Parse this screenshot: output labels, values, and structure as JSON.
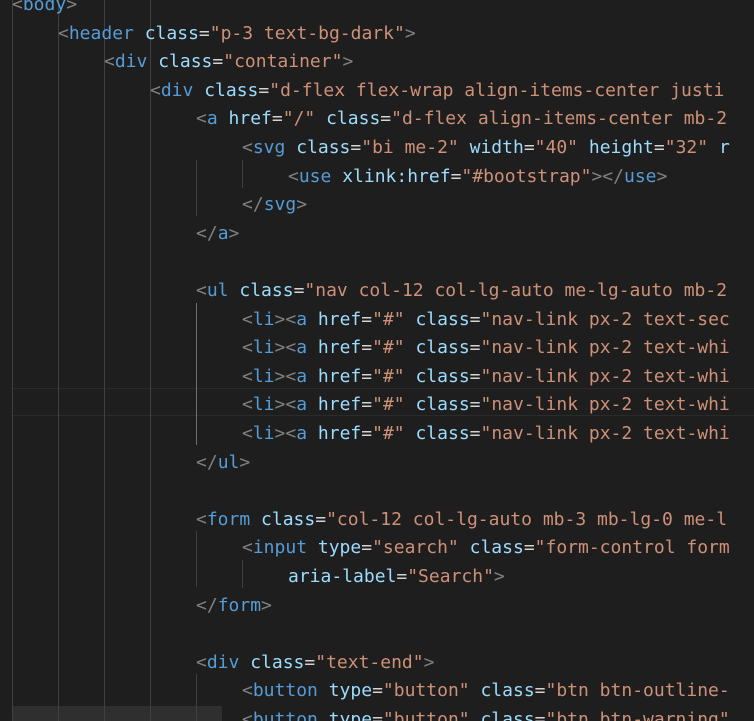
{
  "editor": {
    "lines": [
      [
        {
          "c": "b",
          "v": "<"
        },
        {
          "c": "t",
          "v": "body"
        },
        {
          "c": "b",
          "v": ">"
        }
      ],
      [
        {
          "c": "b",
          "v": "<"
        },
        {
          "c": "t",
          "v": "header"
        },
        {
          "c": "e",
          "v": " "
        },
        {
          "c": "a",
          "v": "class"
        },
        {
          "c": "e",
          "v": "="
        },
        {
          "c": "s",
          "v": "\"p-3 text-bg-dark\""
        },
        {
          "c": "b",
          "v": ">"
        }
      ],
      [
        {
          "c": "b",
          "v": "<"
        },
        {
          "c": "t",
          "v": "div"
        },
        {
          "c": "e",
          "v": " "
        },
        {
          "c": "a",
          "v": "class"
        },
        {
          "c": "e",
          "v": "="
        },
        {
          "c": "s",
          "v": "\"container\""
        },
        {
          "c": "b",
          "v": ">"
        }
      ],
      [
        {
          "c": "b",
          "v": "<"
        },
        {
          "c": "t",
          "v": "div"
        },
        {
          "c": "e",
          "v": " "
        },
        {
          "c": "a",
          "v": "class"
        },
        {
          "c": "e",
          "v": "="
        },
        {
          "c": "s",
          "v": "\"d-flex flex-wrap align-items-center justi"
        }
      ],
      [
        {
          "c": "b",
          "v": "<"
        },
        {
          "c": "t",
          "v": "a"
        },
        {
          "c": "e",
          "v": " "
        },
        {
          "c": "a",
          "v": "href"
        },
        {
          "c": "e",
          "v": "="
        },
        {
          "c": "s",
          "v": "\"/\""
        },
        {
          "c": "e",
          "v": " "
        },
        {
          "c": "a",
          "v": "class"
        },
        {
          "c": "e",
          "v": "="
        },
        {
          "c": "s",
          "v": "\"d-flex align-items-center mb-2"
        }
      ],
      [
        {
          "c": "b",
          "v": "<"
        },
        {
          "c": "t",
          "v": "svg"
        },
        {
          "c": "e",
          "v": " "
        },
        {
          "c": "a",
          "v": "class"
        },
        {
          "c": "e",
          "v": "="
        },
        {
          "c": "s",
          "v": "\"bi me-2\""
        },
        {
          "c": "e",
          "v": " "
        },
        {
          "c": "a",
          "v": "width"
        },
        {
          "c": "e",
          "v": "="
        },
        {
          "c": "s",
          "v": "\"40\""
        },
        {
          "c": "e",
          "v": " "
        },
        {
          "c": "a",
          "v": "height"
        },
        {
          "c": "e",
          "v": "="
        },
        {
          "c": "s",
          "v": "\"32\""
        },
        {
          "c": "e",
          "v": " "
        },
        {
          "c": "a",
          "v": "r"
        }
      ],
      [
        {
          "c": "b",
          "v": "<"
        },
        {
          "c": "t",
          "v": "use"
        },
        {
          "c": "e",
          "v": " "
        },
        {
          "c": "a",
          "v": "xlink:href"
        },
        {
          "c": "e",
          "v": "="
        },
        {
          "c": "s",
          "v": "\"#bootstrap\""
        },
        {
          "c": "b",
          "v": "></"
        },
        {
          "c": "t",
          "v": "use"
        },
        {
          "c": "b",
          "v": ">"
        }
      ],
      [
        {
          "c": "b",
          "v": "</"
        },
        {
          "c": "t",
          "v": "svg"
        },
        {
          "c": "b",
          "v": ">"
        }
      ],
      [
        {
          "c": "b",
          "v": "</"
        },
        {
          "c": "t",
          "v": "a"
        },
        {
          "c": "b",
          "v": ">"
        }
      ],
      [],
      [
        {
          "c": "b",
          "v": "<"
        },
        {
          "c": "t",
          "v": "ul"
        },
        {
          "c": "e",
          "v": " "
        },
        {
          "c": "a",
          "v": "class"
        },
        {
          "c": "e",
          "v": "="
        },
        {
          "c": "s",
          "v": "\"nav col-12 col-lg-auto me-lg-auto mb-2"
        }
      ],
      [
        {
          "c": "b",
          "v": "<"
        },
        {
          "c": "t",
          "v": "li"
        },
        {
          "c": "b",
          "v": "><"
        },
        {
          "c": "t",
          "v": "a"
        },
        {
          "c": "e",
          "v": " "
        },
        {
          "c": "a",
          "v": "href"
        },
        {
          "c": "e",
          "v": "="
        },
        {
          "c": "s",
          "v": "\"#\""
        },
        {
          "c": "e",
          "v": " "
        },
        {
          "c": "a",
          "v": "class"
        },
        {
          "c": "e",
          "v": "="
        },
        {
          "c": "s",
          "v": "\"nav-link px-2 text-sec"
        }
      ],
      [
        {
          "c": "b",
          "v": "<"
        },
        {
          "c": "t",
          "v": "li"
        },
        {
          "c": "b",
          "v": "><"
        },
        {
          "c": "t",
          "v": "a"
        },
        {
          "c": "e",
          "v": " "
        },
        {
          "c": "a",
          "v": "href"
        },
        {
          "c": "e",
          "v": "="
        },
        {
          "c": "s",
          "v": "\"#\""
        },
        {
          "c": "e",
          "v": " "
        },
        {
          "c": "a",
          "v": "class"
        },
        {
          "c": "e",
          "v": "="
        },
        {
          "c": "s",
          "v": "\"nav-link px-2 text-whi"
        }
      ],
      [
        {
          "c": "b",
          "v": "<"
        },
        {
          "c": "t",
          "v": "li"
        },
        {
          "c": "b",
          "v": "><"
        },
        {
          "c": "t",
          "v": "a"
        },
        {
          "c": "e",
          "v": " "
        },
        {
          "c": "a",
          "v": "href"
        },
        {
          "c": "e",
          "v": "="
        },
        {
          "c": "s",
          "v": "\"#\""
        },
        {
          "c": "e",
          "v": " "
        },
        {
          "c": "a",
          "v": "class"
        },
        {
          "c": "e",
          "v": "="
        },
        {
          "c": "s",
          "v": "\"nav-link px-2 text-whi"
        }
      ],
      [
        {
          "c": "b",
          "v": "<"
        },
        {
          "c": "t",
          "v": "li"
        },
        {
          "c": "b",
          "v": "><"
        },
        {
          "c": "t",
          "v": "a"
        },
        {
          "c": "e",
          "v": " "
        },
        {
          "c": "a",
          "v": "href"
        },
        {
          "c": "e",
          "v": "="
        },
        {
          "c": "s",
          "v": "\"#\""
        },
        {
          "c": "e",
          "v": " "
        },
        {
          "c": "a",
          "v": "class"
        },
        {
          "c": "e",
          "v": "="
        },
        {
          "c": "s",
          "v": "\"nav-link px-2 text-whi"
        }
      ],
      [
        {
          "c": "b",
          "v": "<"
        },
        {
          "c": "t",
          "v": "li"
        },
        {
          "c": "b",
          "v": "><"
        },
        {
          "c": "t",
          "v": "a"
        },
        {
          "c": "e",
          "v": " "
        },
        {
          "c": "a",
          "v": "href"
        },
        {
          "c": "e",
          "v": "="
        },
        {
          "c": "s",
          "v": "\"#\""
        },
        {
          "c": "e",
          "v": " "
        },
        {
          "c": "a",
          "v": "class"
        },
        {
          "c": "e",
          "v": "="
        },
        {
          "c": "s",
          "v": "\"nav-link px-2 text-whi"
        }
      ],
      [
        {
          "c": "b",
          "v": "</"
        },
        {
          "c": "t",
          "v": "ul"
        },
        {
          "c": "b",
          "v": ">"
        }
      ],
      [],
      [
        {
          "c": "b",
          "v": "<"
        },
        {
          "c": "t",
          "v": "form"
        },
        {
          "c": "e",
          "v": " "
        },
        {
          "c": "a",
          "v": "class"
        },
        {
          "c": "e",
          "v": "="
        },
        {
          "c": "s",
          "v": "\"col-12 col-lg-auto mb-3 mb-lg-0 me-l"
        }
      ],
      [
        {
          "c": "b",
          "v": "<"
        },
        {
          "c": "t",
          "v": "input"
        },
        {
          "c": "e",
          "v": " "
        },
        {
          "c": "a",
          "v": "type"
        },
        {
          "c": "e",
          "v": "="
        },
        {
          "c": "s",
          "v": "\"search\""
        },
        {
          "c": "e",
          "v": " "
        },
        {
          "c": "a",
          "v": "class"
        },
        {
          "c": "e",
          "v": "="
        },
        {
          "c": "s",
          "v": "\"form-control form"
        }
      ],
      [
        {
          "c": "a",
          "v": "aria-label"
        },
        {
          "c": "e",
          "v": "="
        },
        {
          "c": "s",
          "v": "\"Search\""
        },
        {
          "c": "b",
          "v": ">"
        }
      ],
      [
        {
          "c": "b",
          "v": "</"
        },
        {
          "c": "t",
          "v": "form"
        },
        {
          "c": "b",
          "v": ">"
        }
      ],
      [],
      [
        {
          "c": "b",
          "v": "<"
        },
        {
          "c": "t",
          "v": "div"
        },
        {
          "c": "e",
          "v": " "
        },
        {
          "c": "a",
          "v": "class"
        },
        {
          "c": "e",
          "v": "="
        },
        {
          "c": "s",
          "v": "\"text-end\""
        },
        {
          "c": "b",
          "v": ">"
        }
      ],
      [
        {
          "c": "b",
          "v": "<"
        },
        {
          "c": "t",
          "v": "button"
        },
        {
          "c": "e",
          "v": " "
        },
        {
          "c": "a",
          "v": "type"
        },
        {
          "c": "e",
          "v": "="
        },
        {
          "c": "s",
          "v": "\"button\""
        },
        {
          "c": "e",
          "v": " "
        },
        {
          "c": "a",
          "v": "class"
        },
        {
          "c": "e",
          "v": "="
        },
        {
          "c": "s",
          "v": "\"btn btn-outline-"
        }
      ],
      [
        {
          "c": "b",
          "v": "<"
        },
        {
          "c": "t",
          "v": "button"
        },
        {
          "c": "e",
          "v": " "
        },
        {
          "c": "a",
          "v": "type"
        },
        {
          "c": "e",
          "v": "="
        },
        {
          "c": "s",
          "v": "\"button\""
        },
        {
          "c": "e",
          "v": " "
        },
        {
          "c": "a",
          "v": "class"
        },
        {
          "c": "e",
          "v": "="
        },
        {
          "c": "s",
          "v": "\"btn btn-warning\""
        }
      ]
    ]
  }
}
